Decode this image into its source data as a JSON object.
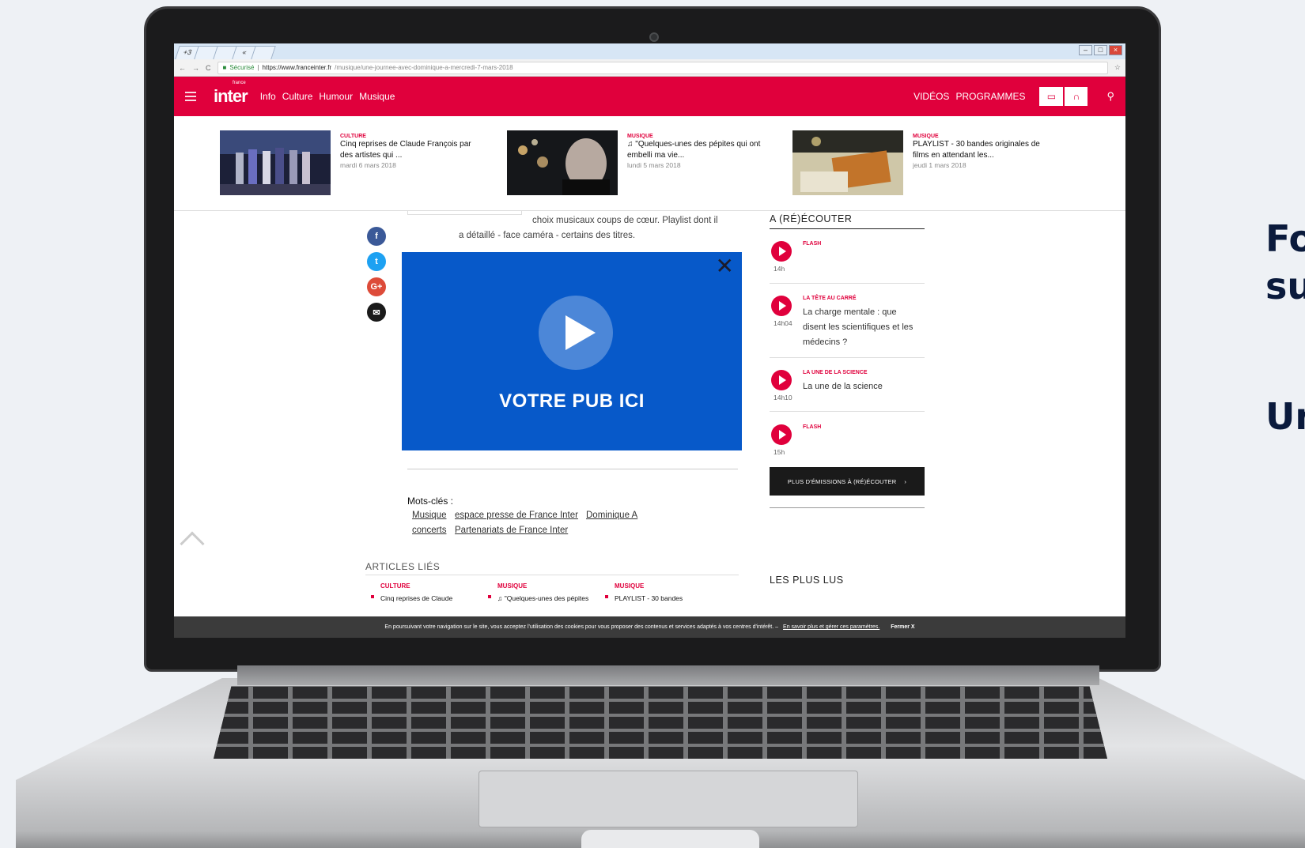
{
  "side_text": [
    "Fo",
    "su",
    "Un"
  ],
  "browser": {
    "tabs": [
      "+3",
      "",
      "",
      "«"
    ],
    "secure_label": "Sécurisé",
    "url_host": "https://www.franceinter.fr",
    "url_path": "/musique/une-journee-avec-dominique-a-mercredi-7-mars-2018"
  },
  "nav": {
    "logo": "inter",
    "logo_small": "france",
    "links": [
      "Info",
      "Culture",
      "Humour",
      "Musique"
    ],
    "right_links": [
      "VIDÉOS",
      "PROGRAMMES"
    ]
  },
  "teasers": [
    {
      "category": "CULTURE",
      "title": "Cinq reprises de Claude François par des artistes qui ...",
      "date": "mardi 6 mars 2018"
    },
    {
      "category": "MUSIQUE",
      "title": "♫ \"Quelques-unes des pépites qui ont embelli ma vie...",
      "date": "lundi 5 mars 2018"
    },
    {
      "category": "MUSIQUE",
      "title": "PLAYLIST - 30 bandes originales de films en attendant les...",
      "date": "jeudi 1 mars 2018"
    }
  ],
  "article": {
    "lead_line1": "choix musicaux coups de cœur.  Playlist dont il",
    "lead_line2": "a détaillé - face caméra - certains des titres.",
    "keywords_title": "Mots-clés :",
    "keywords": [
      "Musique",
      "espace presse de France Inter",
      "Dominique A",
      "concerts",
      "Partenariats de France Inter"
    ]
  },
  "ad": {
    "label": "VOTRE PUB ICI"
  },
  "related": {
    "heading": "ARTICLES LIÉS",
    "items": [
      {
        "category": "CULTURE",
        "title": "Cinq reprises de Claude"
      },
      {
        "category": "MUSIQUE",
        "title": "♫ \"Quelques-unes des pépites"
      },
      {
        "category": "MUSIQUE",
        "title": "PLAYLIST - 30 bandes"
      }
    ]
  },
  "sidebar": {
    "heading": "A (RÉ)ÉCOUTER",
    "items": [
      {
        "category": "FLASH",
        "title": "",
        "time": "14h"
      },
      {
        "category": "LA TÊTE AU CARRÉ",
        "title": "La charge mentale : que disent les scientifiques et les médecins ?",
        "time": "14h04"
      },
      {
        "category": "LA UNE DE LA SCIENCE",
        "title": "La une de la science",
        "time": "14h10"
      },
      {
        "category": "FLASH",
        "title": "",
        "time": "15h"
      }
    ],
    "more_button": "PLUS D'ÉMISSIONS À (RÉ)ÉCOUTER",
    "most_read": "LES PLUS LUS"
  },
  "cookie": {
    "text": "En poursuivant votre navigation sur le site, vous acceptez l'utilisation des cookies pour vous proposer des contenus et services adaptés à vos centres d'intérêt. –",
    "link": "En savoir plus et gérer ces paramètres.",
    "close": "Fermer X"
  },
  "colors": {
    "brand": "#e0003c",
    "ad_blue": "#0759c9"
  }
}
